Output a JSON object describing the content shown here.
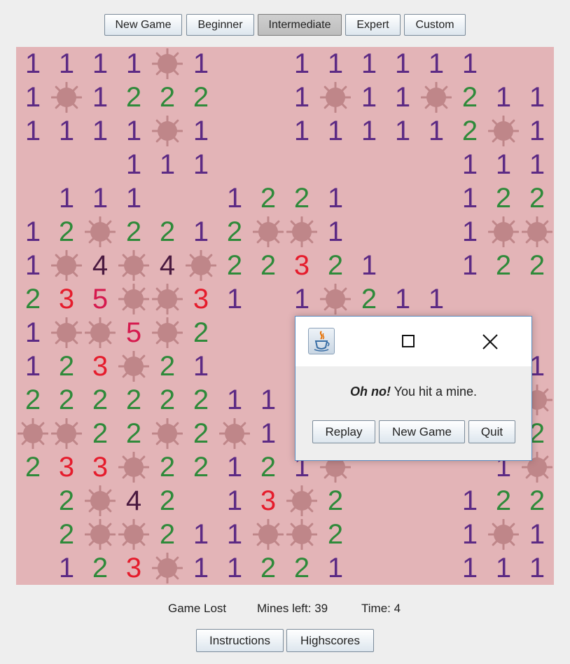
{
  "toolbar": {
    "new_game": "New Game",
    "beginner": "Beginner",
    "intermediate": "Intermediate",
    "expert": "Expert",
    "custom": "Custom",
    "selected": "Intermediate"
  },
  "board": {
    "rows": [
      "1111*1..111111..",
      "1*1222..1*11*211",
      "1111*1..111112*1",
      "...111.......111",
      ".111..1221...122",
      "12*2212**1...1**",
      "1*4*4*22321..122",
      "235**31.1*211...",
      "1**5*2..........",
      "123*21.........1",
      "22222211.......*",
      "**22*2*1.......2",
      "233*22121*....1*",
      ".2*42.13*2...122",
      ".2**211**2...1*1",
      ".123*11221...111"
    ],
    "number_colors": {
      "1": "#5c2a84",
      "2": "#2f8a3a",
      "3": "#e51c2c",
      "4": "#4a1a40",
      "5": "#d51a4e"
    },
    "mine_color": "#bf8689",
    "background": "#e3b4b7"
  },
  "status": {
    "result": "Game Lost",
    "mines_left": "Mines left: 39",
    "time": "Time: 4"
  },
  "bottom": {
    "instructions": "Instructions",
    "highscores": "Highscores"
  },
  "dialog": {
    "icon": "java-icon",
    "message_bold": "Oh no!",
    "message_rest": " You hit a mine.",
    "replay": "Replay",
    "new_game": "New Game",
    "quit": "Quit"
  }
}
